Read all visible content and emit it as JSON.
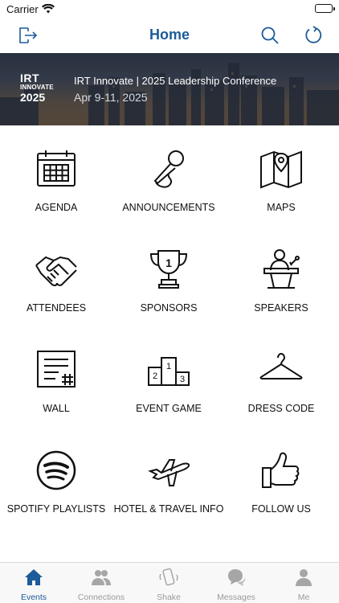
{
  "status_bar": {
    "carrier": "Carrier"
  },
  "nav": {
    "title": "Home"
  },
  "banner": {
    "logo_line1": "IRT",
    "logo_line2": "INNOVATE",
    "logo_line3": "2025",
    "title": "IRT Innovate | 2025 Leadership Conference",
    "dates": "Apr 9-11, 2025"
  },
  "tiles": [
    {
      "label": "AGENDA",
      "icon": "calendar-icon"
    },
    {
      "label": "ANNOUNCEMENTS",
      "icon": "microphone-icon"
    },
    {
      "label": "MAPS",
      "icon": "map-icon"
    },
    {
      "label": "ATTENDEES",
      "icon": "handshake-icon"
    },
    {
      "label": "SPONSORS",
      "icon": "trophy-icon"
    },
    {
      "label": "SPEAKERS",
      "icon": "podium-icon"
    },
    {
      "label": "WALL",
      "icon": "note-icon"
    },
    {
      "label": "EVENT GAME",
      "icon": "winners-podium-icon"
    },
    {
      "label": "DRESS CODE",
      "icon": "hanger-icon"
    },
    {
      "label": "SPOTIFY PLAYLISTS",
      "icon": "spotify-icon"
    },
    {
      "label": "HOTEL & TRAVEL INFO",
      "icon": "airplane-icon"
    },
    {
      "label": "FOLLOW US",
      "icon": "thumbs-up-icon"
    }
  ],
  "tabs": [
    {
      "label": "Events",
      "active": true
    },
    {
      "label": "Connections",
      "active": false
    },
    {
      "label": "Shake",
      "active": false
    },
    {
      "label": "Messages",
      "active": false
    },
    {
      "label": "Me",
      "active": false
    }
  ],
  "colors": {
    "accent": "#1d5b99",
    "inactive_tab": "#9a9a9a"
  }
}
